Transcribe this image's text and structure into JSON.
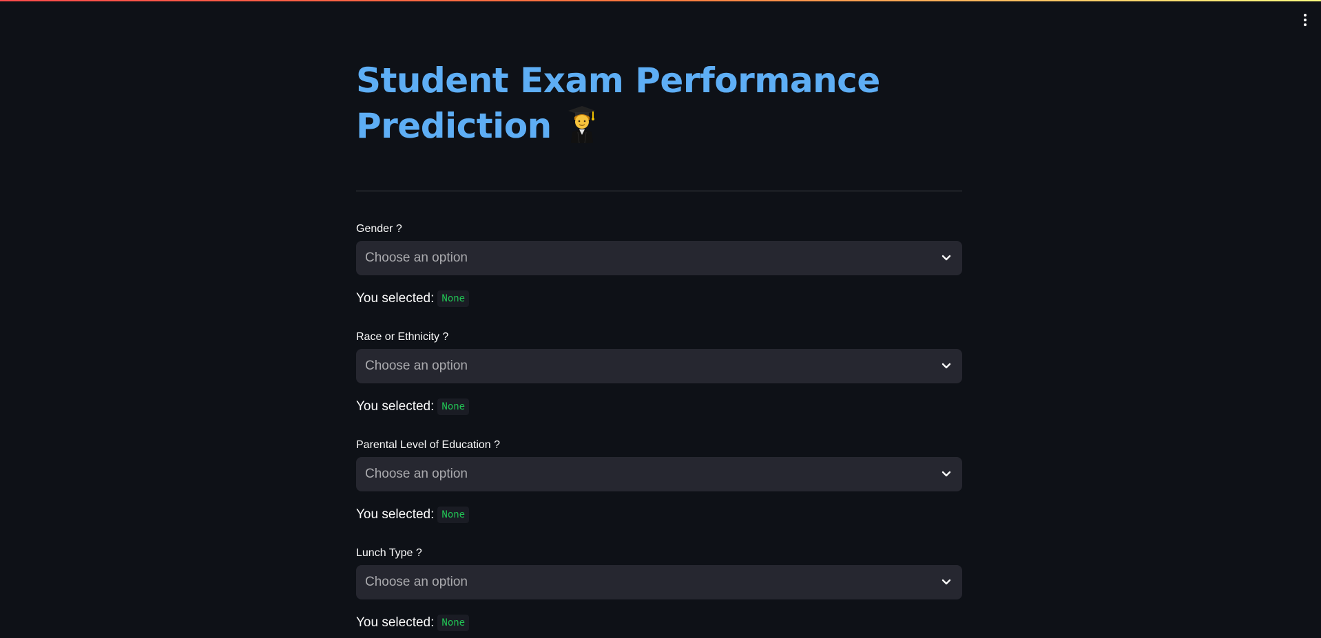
{
  "header": {
    "title_line1": "Student Exam Performance",
    "title_line2": "Prediction",
    "title_icon": "graduate-emoji-icon",
    "menu_icon": "vertical-dots-icon"
  },
  "form": {
    "fields": [
      {
        "label": "Gender ?",
        "placeholder": "Choose an option",
        "selected_prefix": "You selected:",
        "selected_value": "None"
      },
      {
        "label": "Race or Ethnicity ?",
        "placeholder": "Choose an option",
        "selected_prefix": "You selected:",
        "selected_value": "None"
      },
      {
        "label": "Parental Level of Education ?",
        "placeholder": "Choose an option",
        "selected_prefix": "You selected:",
        "selected_value": "None"
      },
      {
        "label": "Lunch Type ?",
        "placeholder": "Choose an option",
        "selected_prefix": "You selected:",
        "selected_value": "None"
      }
    ]
  },
  "colors": {
    "background": "#0e1117",
    "title": "#5eaef5",
    "select_bg": "#262730",
    "code_text": "#21c354"
  }
}
